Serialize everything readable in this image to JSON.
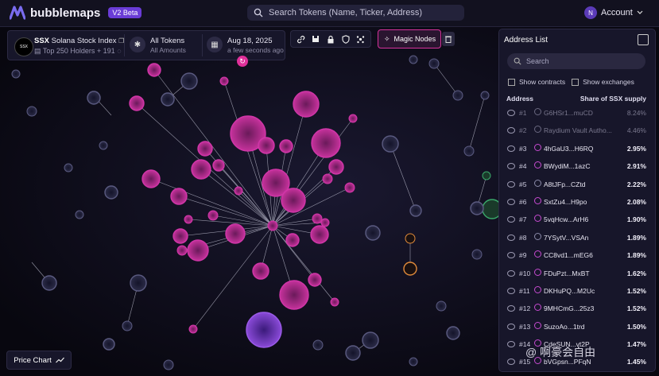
{
  "app": {
    "name": "bubblemaps",
    "badge": "V2 Beta"
  },
  "search": {
    "placeholder": "Search Tokens (Name, Ticker, Address)"
  },
  "account": {
    "avatar_letter": "N",
    "label": "Account"
  },
  "token": {
    "ticker": "SSX",
    "name": "Solana Stock Index",
    "logo_text": "SSX",
    "subtitle": "Top 250 Holders + 191"
  },
  "filter": {
    "label": "All Tokens",
    "sub": "All Amounts"
  },
  "date": {
    "label": "Aug 18, 2025",
    "sub": "a few seconds ago"
  },
  "magic_nodes": {
    "label": "Magic Nodes"
  },
  "address_list": {
    "title": "Address List",
    "search_placeholder": "Search",
    "show_contracts": "Show contracts",
    "show_exchanges": "Show exchanges",
    "col_address": "Address",
    "col_share": "Share of SSX supply",
    "rows": [
      {
        "rank": "#1",
        "addr": "G6HSr1...muCD",
        "pct": "8.24%",
        "dim": true
      },
      {
        "rank": "#2",
        "addr": "Raydium Vault Autho...",
        "pct": "4.46%",
        "dim": true
      },
      {
        "rank": "#3",
        "addr": "4hGaU3...H6RQ",
        "pct": "2.95%",
        "color": "#c64ad0"
      },
      {
        "rank": "#4",
        "addr": "BWydiM...1azC",
        "pct": "2.91%",
        "color": "#c64ad0"
      },
      {
        "rank": "#5",
        "addr": "A8tJFp...CZtd",
        "pct": "2.22%",
        "color": "#8a8aa8"
      },
      {
        "rank": "#6",
        "addr": "SxtZu4...H9po",
        "pct": "2.08%",
        "color": "#c64ad0"
      },
      {
        "rank": "#7",
        "addr": "5vqHcw...ArH6",
        "pct": "1.90%",
        "color": "#c64ad0"
      },
      {
        "rank": "#8",
        "addr": "7YSytV...VSAn",
        "pct": "1.89%",
        "color": "#8a8aa8"
      },
      {
        "rank": "#9",
        "addr": "CC8vd1...mEG6",
        "pct": "1.89%",
        "color": "#c64ad0"
      },
      {
        "rank": "#10",
        "addr": "FDuPzt...MxBT",
        "pct": "1.62%",
        "color": "#c64ad0"
      },
      {
        "rank": "#11",
        "addr": "DKHuPQ...M2Uc",
        "pct": "1.52%",
        "color": "#c64ad0"
      },
      {
        "rank": "#12",
        "addr": "9MHCmG...25z3",
        "pct": "1.52%",
        "color": "#c64ad0"
      },
      {
        "rank": "#13",
        "addr": "SuzoAo...1trd",
        "pct": "1.50%",
        "color": "#c64ad0"
      },
      {
        "rank": "#14",
        "addr": "CdeSUN...vt2P",
        "pct": "1.47%",
        "color": "#c64ad0"
      },
      {
        "rank": "#15",
        "addr": "bVGpsn...PFqN",
        "pct": "1.45%",
        "color": "#c64ad0"
      }
    ]
  },
  "price_chart": {
    "label": "Price Chart"
  },
  "watermark": "@ 啊豪会自由",
  "colors": {
    "accent": "#e0309a",
    "bubble_pink": "#c64ad0",
    "bubble_gray": "#4a4a6a",
    "bubble_orange": "#e08a3a",
    "bubble_green": "#3aa86a",
    "bubble_purple": "#8a4ad8"
  }
}
